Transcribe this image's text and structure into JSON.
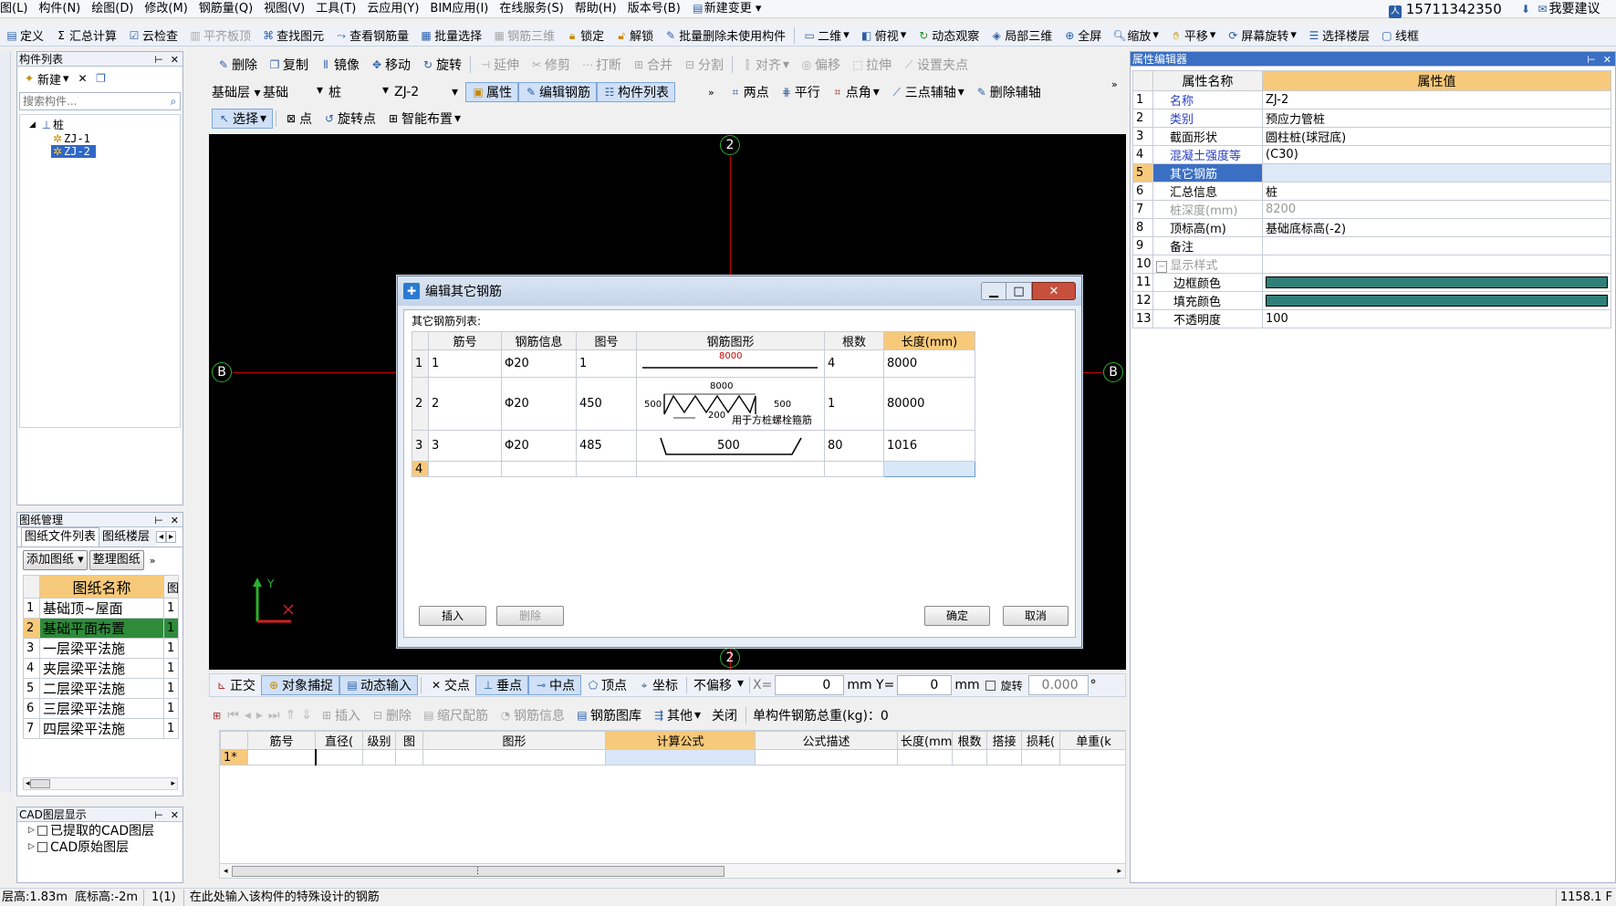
{
  "menu": {
    "items": [
      "图(L)",
      "构件(N)",
      "绘图(D)",
      "修改(M)",
      "钢筋量(Q)",
      "视图(V)",
      "工具(T)",
      "云应用(Y)",
      "BIM应用(I)",
      "在线服务(S)",
      "帮助(H)",
      "版本号(B)",
      "新建变更"
    ],
    "account": "15711342350",
    "feedback": "我要建议"
  },
  "toolbar1": [
    "定义",
    "汇总计算",
    "云检查",
    "平齐板顶",
    "查找图元",
    "查看钢筋量",
    "批量选择",
    "钢筋三维",
    "锁定",
    "解锁",
    "批量删除未使用构件",
    "二维",
    "俯视",
    "动态观察",
    "局部三维",
    "全屏",
    "缩放",
    "平移",
    "屏幕旋转",
    "选择楼层",
    "线框"
  ],
  "toolbar2": [
    "删除",
    "复制",
    "镜像",
    "移动",
    "旋转",
    "延伸",
    "修剪",
    "打断",
    "合并",
    "分割",
    "对齐",
    "偏移",
    "拉伸",
    "设置夹点"
  ],
  "toolbar3": {
    "floor": "基础层",
    "cat1": "基础",
    "cat2": "桩",
    "comp": "ZJ-2",
    "buttons": [
      "属性",
      "编辑钢筋",
      "构件列表"
    ],
    "aux": [
      "两点",
      "平行",
      "点角",
      "三点辅轴",
      "删除辅轴"
    ]
  },
  "toolbar4": [
    "选择",
    "点",
    "旋转点",
    "智能布置"
  ],
  "component_list": {
    "title": "构件列表",
    "new": "新建",
    "search_placeholder": "搜索构件...",
    "root": "桩",
    "children": [
      "ZJ-1",
      "ZJ-2"
    ]
  },
  "drawing_mgr": {
    "title": "图纸管理",
    "tabs": [
      "图纸文件列表",
      "图纸楼层"
    ],
    "add": "添加图纸",
    "arrange": "整理图纸",
    "col_name": "图纸名称",
    "col_short": "图",
    "rows": [
      {
        "n": "1",
        "name": "基础顶~屋面",
        "v": "1"
      },
      {
        "n": "2",
        "name": "基础平面布置",
        "v": "1"
      },
      {
        "n": "3",
        "name": "一层梁平法施",
        "v": "1"
      },
      {
        "n": "4",
        "name": "夹层梁平法施",
        "v": "1"
      },
      {
        "n": "5",
        "name": "二层梁平法施",
        "v": "1"
      },
      {
        "n": "6",
        "name": "三层梁平法施",
        "v": "1"
      },
      {
        "n": "7",
        "name": "四层梁平法施",
        "v": "1"
      }
    ]
  },
  "cad_layers": {
    "title": "CAD图层显示",
    "items": [
      "已提取的CAD图层",
      "CAD原始图层"
    ]
  },
  "axes": {
    "top": "2",
    "bottom": "2",
    "left": "B",
    "right": "B",
    "y": "Y"
  },
  "dialog": {
    "title": "编辑其它钢筋",
    "list_label": "其它钢筋列表:",
    "headers": [
      "筋号",
      "钢筋信息",
      "图号",
      "钢筋图形",
      "根数",
      "长度(mm)"
    ],
    "rows": [
      {
        "n": "1",
        "bar_no": "1",
        "info": "Φ20",
        "fig": "1",
        "count": "4",
        "len": "8000",
        "shape_label": "8000"
      },
      {
        "n": "2",
        "bar_no": "2",
        "info": "Φ20",
        "fig": "450",
        "count": "1",
        "len": "80000",
        "shape_top": "8000",
        "shape_left": "500",
        "shape_right": "500",
        "shape_pitch": "200",
        "shape_note": "用于方桩螺栓箍筋"
      },
      {
        "n": "3",
        "bar_no": "3",
        "info": "Φ20",
        "fig": "485",
        "count": "80",
        "len": "1016",
        "shape_label": "500"
      },
      {
        "n": "4",
        "bar_no": "",
        "info": "",
        "fig": "",
        "count": "",
        "len": ""
      }
    ],
    "btn_insert": "插入",
    "btn_delete": "删除",
    "btn_ok": "确定",
    "btn_cancel": "取消"
  },
  "snap_bar": {
    "items": [
      "正交",
      "对象捕捉",
      "动态输入",
      "交点",
      "垂点",
      "中点",
      "顶点",
      "坐标"
    ],
    "offset": "不偏移",
    "x_label": "X=",
    "x_val": "0",
    "y_label": "mm Y=",
    "y_val": "0",
    "mm": "mm",
    "rot_label": "旋转",
    "rot_val": "0.000",
    "deg": "°"
  },
  "rebar_bar": {
    "items": [
      "插入",
      "删除",
      "缩尺配筋",
      "钢筋信息",
      "钢筋图库",
      "其他",
      "关闭"
    ],
    "total": "单构件钢筋总重(kg)：0"
  },
  "rebar_table": {
    "headers": [
      "筋号",
      "直径(",
      "级别",
      "图",
      "图形",
      "计算公式",
      "公式描述",
      "长度(mm",
      "根数",
      "搭接",
      "损耗(",
      "单重(k"
    ],
    "row1": "1*"
  },
  "props": {
    "title": "属性编辑器",
    "col_name": "属性名称",
    "col_val": "属性值",
    "rows": [
      {
        "n": "1",
        "name": "名称",
        "val": "ZJ-2",
        "blue": true
      },
      {
        "n": "2",
        "name": "类别",
        "val": "预应力管桩",
        "blue": true
      },
      {
        "n": "3",
        "name": "截面形状",
        "val": "圆柱桩(球冠底)"
      },
      {
        "n": "4",
        "name": "混凝土强度等",
        "val": "(C30)",
        "blue": true
      },
      {
        "n": "5",
        "name": "其它钢筋",
        "val": "",
        "sel": true
      },
      {
        "n": "6",
        "name": "汇总信息",
        "val": "桩"
      },
      {
        "n": "7",
        "name": "桩深度(mm)",
        "val": "8200",
        "gray": true
      },
      {
        "n": "8",
        "name": "顶标高(m)",
        "val": "基础底标高(-2)"
      },
      {
        "n": "9",
        "name": "备注",
        "val": ""
      },
      {
        "n": "10",
        "name": "显示样式",
        "val": "",
        "gray": true,
        "group": true
      },
      {
        "n": "11",
        "name": "边框颜色",
        "val": "",
        "swatch": "#2f7f78"
      },
      {
        "n": "12",
        "name": "填充颜色",
        "val": "",
        "swatch": "#2f7f78"
      },
      {
        "n": "13",
        "name": "不透明度",
        "val": "100"
      }
    ]
  },
  "status": {
    "floor_h": "层高:1.83m",
    "bottom_h": "底标高:-2m",
    "count": "1(1)",
    "hint": "在此处输入该构件的特殊设计的钢筋",
    "right": "1158.1 F"
  }
}
